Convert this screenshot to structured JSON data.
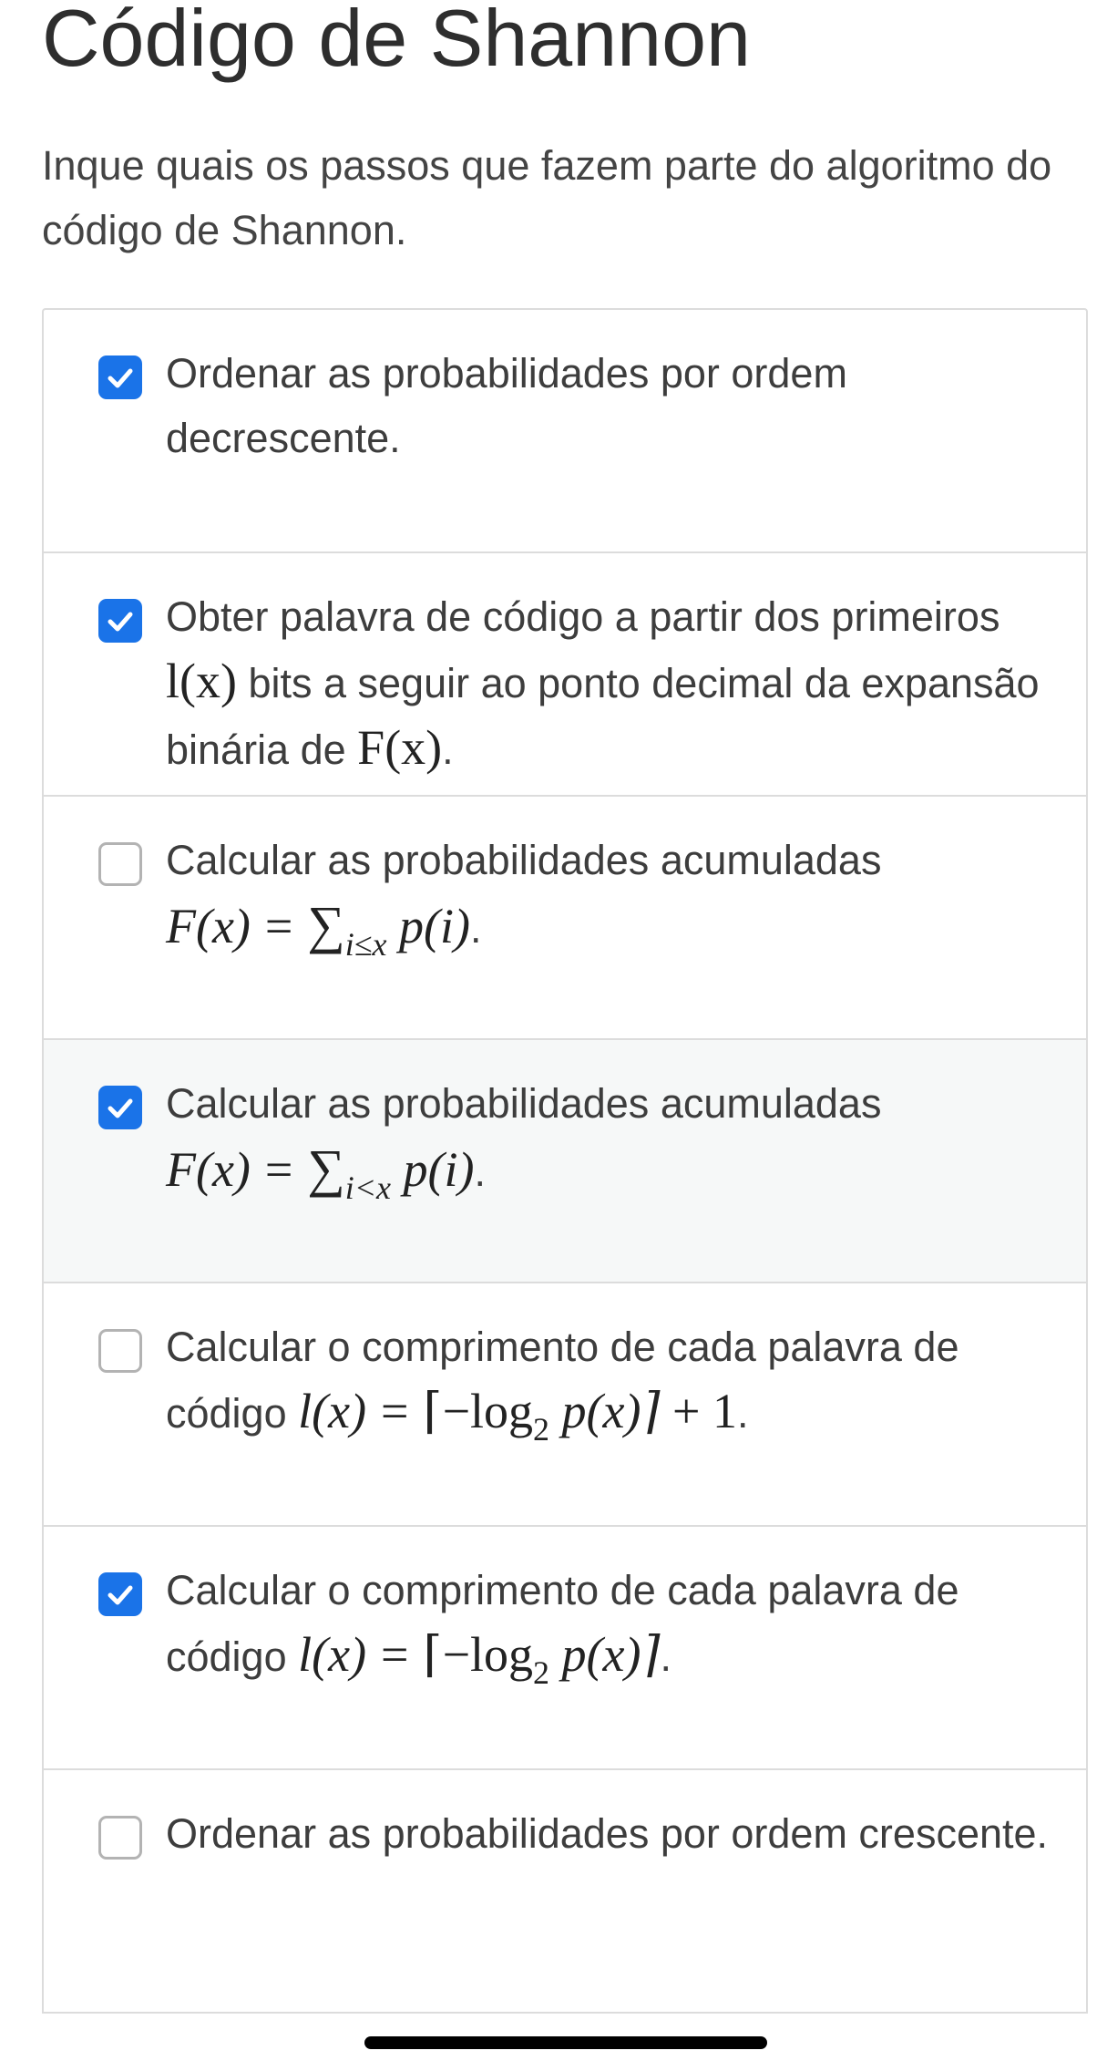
{
  "page": {
    "title": "Código de Shannon",
    "prompt": "Inque quais os passos que fazem parte do algoritmo do código de Shannon."
  },
  "options": [
    {
      "checked": true,
      "text": "Ordenar as probabilidades por ordem decrescente."
    },
    {
      "checked": true,
      "text_a": "Obter palavra de código a partir dos primeiros ",
      "math_a": "l(x)",
      "text_b": " bits a seguir ao ponto decimal da expansão binária de ",
      "math_b": "F(x)",
      "text_c": "."
    },
    {
      "checked": false,
      "text": "Calcular as probabilidades acumuladas",
      "math": "F(x) = ∑_{i≤x} p(i)",
      "math_lhs": "F(x)",
      "math_eq": "=",
      "math_sum": "∑",
      "math_sub": "i≤x",
      "math_rhs": "p(i)",
      "suffix": "."
    },
    {
      "checked": true,
      "hover": true,
      "text": "Calcular as probabilidades acumuladas",
      "math": "F(x) = ∑_{i<x} p(i)",
      "math_lhs": "F(x)",
      "math_eq": "=",
      "math_sum": "∑",
      "math_sub": "i<x",
      "math_rhs": "p(i)",
      "suffix": "."
    },
    {
      "checked": false,
      "text_a": "Calcular o comprimento de cada palavra de código ",
      "math": "l(x) = ⌈−log₂ p(x)⌉ + 1",
      "math_lhs": "l(x)",
      "math_eq": "=",
      "math_open": "⌈−log",
      "math_sub": "2",
      "math_mid": " p(x)⌉",
      "math_tail": " + 1",
      "suffix": "."
    },
    {
      "checked": true,
      "text_a": "Calcular o comprimento de cada palavra de código ",
      "math": "l(x) = ⌈−log₂ p(x)⌉",
      "math_lhs": "l(x)",
      "math_eq": "=",
      "math_open": "⌈−log",
      "math_sub": "2",
      "math_mid": " p(x)⌉",
      "suffix": "."
    },
    {
      "checked": false,
      "text": "Ordenar as probabilidades por ordem crescente."
    }
  ],
  "colors": {
    "accent": "#1a73e8",
    "hover_background": "#f6f8f8",
    "border": "#dcdcdc"
  },
  "icons": {
    "checked": "check-icon"
  }
}
